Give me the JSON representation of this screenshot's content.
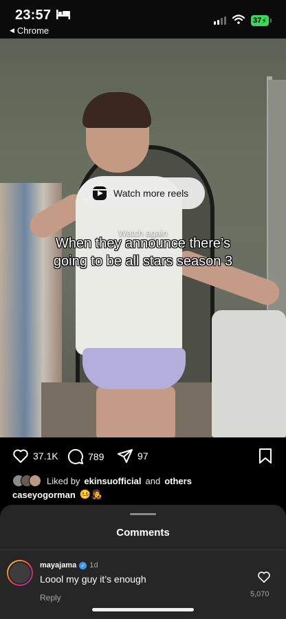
{
  "status_bar": {
    "time": "23:57",
    "back_app": "Chrome",
    "battery": "37"
  },
  "video": {
    "watch_more_label": "Watch more reels",
    "watch_again_label": "Watch again",
    "caption_line1": "When they announce there’s",
    "caption_line2": "going to be all stars season 3"
  },
  "actions": {
    "likes": "37.1K",
    "comments": "789",
    "shares": "97"
  },
  "liked_by": {
    "prefix": "Liked by",
    "user": "ekinsuofficial",
    "and": "and",
    "others": "others"
  },
  "poster": {
    "username": "caseyogorman",
    "emoji": "🤒🧑‍🎤"
  },
  "comments_sheet": {
    "title": "Comments",
    "comment": {
      "username": "mayajama",
      "time": "1d",
      "text": "Loool my guy it’s enough",
      "reply": "Reply",
      "likes": "5,070"
    }
  },
  "colors": {
    "battery": "#3fd45a",
    "sheet_bg": "#262626",
    "verified": "#3897f0"
  }
}
